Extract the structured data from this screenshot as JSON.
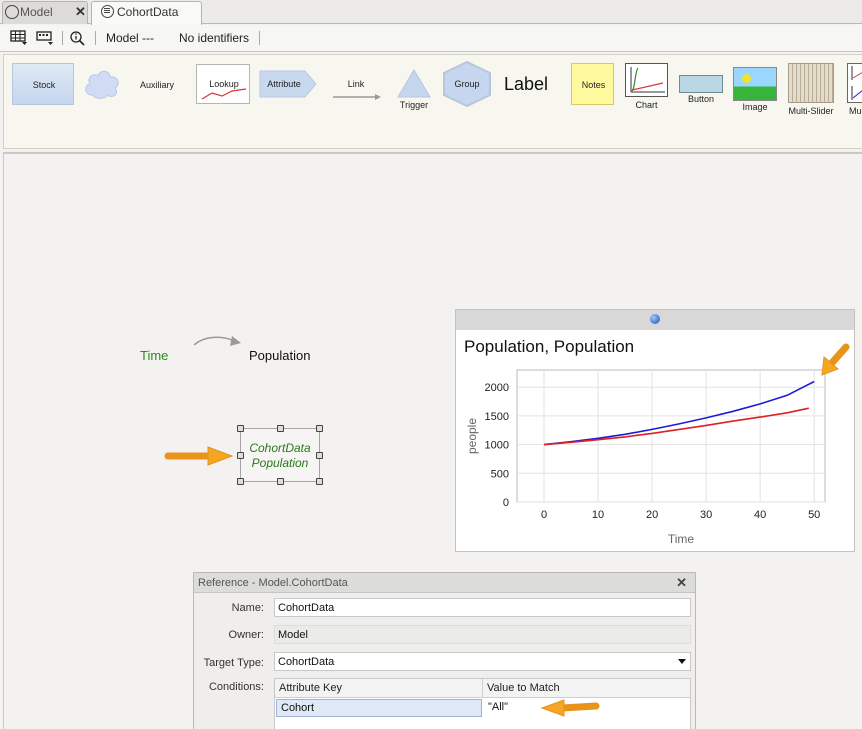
{
  "tabs": [
    {
      "label": "Model",
      "active": false
    },
    {
      "label": "CohortData",
      "active": true
    }
  ],
  "tab_close_glyph": "✕",
  "toolbar": {
    "model_label": "Model ---",
    "identifiers_label": "No identifiers"
  },
  "palette": {
    "items": [
      "Stock",
      "Auxiliary",
      "Lookup",
      "Attribute",
      "Link",
      "Trigger",
      "Group",
      "Label",
      "Notes",
      "Chart",
      "Button",
      "Image",
      "Multi-Slider",
      "Multi"
    ]
  },
  "canvas": {
    "time_label": "Time",
    "population_label": "Population",
    "cohort_node_line1": "CohortData",
    "cohort_node_line2": "Population"
  },
  "chart_data": {
    "type": "line",
    "title": "Population, Population",
    "xlabel": "Time",
    "ylabel": "people",
    "xlim": [
      -5,
      52
    ],
    "ylim": [
      0,
      2300
    ],
    "xticks": [
      0,
      10,
      20,
      30,
      40,
      50
    ],
    "yticks": [
      0,
      500,
      1000,
      1500,
      2000
    ],
    "grid": true,
    "series": [
      {
        "color": "#1c1cd6",
        "x": [
          0,
          5,
          10,
          15,
          20,
          25,
          30,
          35,
          40,
          45,
          50
        ],
        "values": [
          1000,
          1050,
          1110,
          1180,
          1265,
          1360,
          1465,
          1580,
          1710,
          1860,
          2100
        ]
      },
      {
        "color": "#e02020",
        "x": [
          0,
          5,
          10,
          15,
          20,
          25,
          30,
          35,
          40,
          45,
          49
        ],
        "values": [
          1000,
          1040,
          1085,
          1135,
          1195,
          1265,
          1335,
          1410,
          1480,
          1555,
          1635
        ]
      }
    ]
  },
  "reference": {
    "title": "Reference - Model.CohortData",
    "close_glyph": "✕",
    "name_label": "Name:",
    "name_value": "CohortData",
    "owner_label": "Owner:",
    "owner_value": "Model",
    "target_type_label": "Target Type:",
    "target_type_value": "CohortData",
    "conditions_label": "Conditions:",
    "conditions": {
      "headers": [
        "Attribute Key",
        "Value to Match"
      ],
      "rows": [
        [
          "Cohort",
          "\"All\""
        ]
      ]
    }
  },
  "colors": {
    "accent_orange": "#f5a623",
    "time_green": "#2a8a1e",
    "series_blue": "#1c1cd6",
    "series_red": "#e02020"
  }
}
